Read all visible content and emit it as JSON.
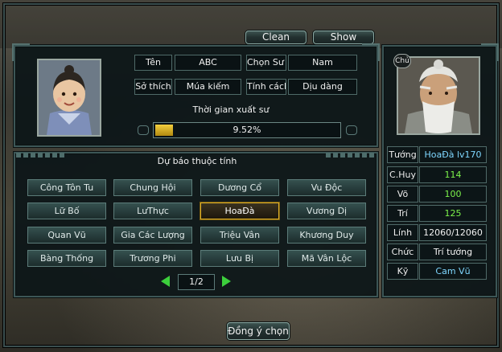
{
  "top_buttons": {
    "clean": "Clean",
    "show": "Show"
  },
  "profile": {
    "name_label": "Tên",
    "name_value": "ABC",
    "choose_label": "Chọn Sư P",
    "choose_value": "Nam",
    "hobby_label": "Sở thích",
    "hobby_value": "Múa kiếm",
    "personality_label": "Tính cách",
    "personality_value": "Dịu dàng"
  },
  "progress": {
    "title": "Thời gian xuất sư",
    "text": "9.52%",
    "fraction": 0.0952
  },
  "forecast": {
    "title": "Dự báo thuộc tính",
    "generals": [
      "Công Tôn Tu",
      "Chung Hội",
      "Dương Cổ",
      "Vu Độc",
      "Lữ Bố",
      "LưThực",
      "HoaĐà",
      "Vương Dị",
      "Quan Vũ",
      "Gia Các Lượng",
      "Triệu Vân",
      "Khương Duy",
      "Bàng Thống",
      "Trương Phi",
      "Lưu Bị",
      "Mã Vân Lộc"
    ],
    "selected_index": 6,
    "page": "1/2"
  },
  "teacher": {
    "badge": "Chủ",
    "stats": [
      {
        "label": "Tướng",
        "value": "HoaĐà lv170",
        "color": "#7fd7ff"
      },
      {
        "label": "C.Huy",
        "value": "114",
        "color": "#7cf24a"
      },
      {
        "label": "Võ",
        "value": "100",
        "color": "#7cf24a"
      },
      {
        "label": "Trí",
        "value": "125",
        "color": "#7cf24a"
      },
      {
        "label": "Lính",
        "value": "12060/12060",
        "color": "#f2f2f2"
      },
      {
        "label": "Chức",
        "value": "Trí tướng",
        "color": "#f2f2f2"
      },
      {
        "label": "Kỹ",
        "value": "Cam Vũ",
        "color": "#7fd7ff"
      }
    ]
  },
  "confirm_button": "Đồng ý chọn"
}
